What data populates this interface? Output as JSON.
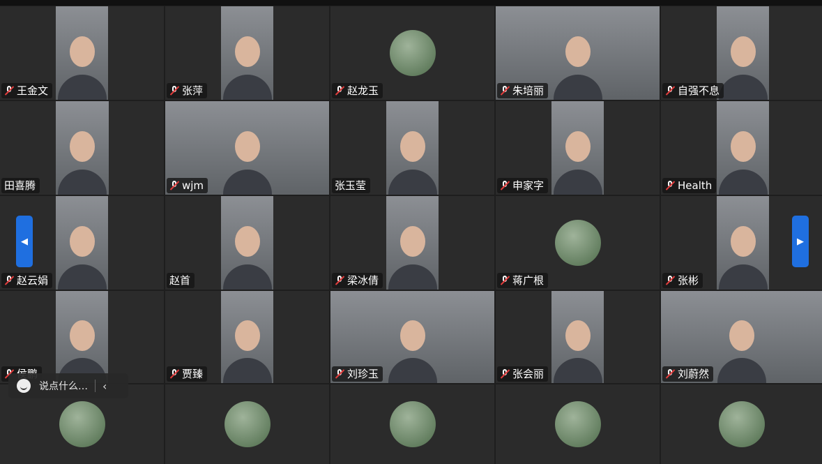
{
  "participants": [
    {
      "name": "王金文",
      "muted": true,
      "type": "video",
      "vx": 80,
      "vw": 75
    },
    {
      "name": "张萍",
      "muted": true,
      "type": "video",
      "vx": 80,
      "vw": 75
    },
    {
      "name": "赵龙玉",
      "muted": true,
      "type": "avatar"
    },
    {
      "name": "朱培丽",
      "muted": true,
      "type": "video",
      "vx": 0,
      "vw": 237
    },
    {
      "name": "自强不息",
      "muted": true,
      "type": "video",
      "vx": 80,
      "vw": 75
    },
    {
      "name": "田喜腾",
      "muted": false,
      "type": "video",
      "vx": 80,
      "vw": 76
    },
    {
      "name": "wjm",
      "muted": true,
      "type": "video",
      "vx": 0,
      "vw": 236
    },
    {
      "name": "张玉莹",
      "muted": false,
      "type": "video",
      "vx": 80,
      "vw": 75
    },
    {
      "name": "申家字",
      "muted": true,
      "type": "video",
      "vx": 80,
      "vw": 75
    },
    {
      "name": "Health",
      "muted": true,
      "type": "video",
      "vx": 80,
      "vw": 75
    },
    {
      "name": "赵云娟",
      "muted": true,
      "type": "video",
      "vx": 80,
      "vw": 75
    },
    {
      "name": "赵首",
      "muted": false,
      "type": "video",
      "vx": 80,
      "vw": 75
    },
    {
      "name": "梁冰倩",
      "muted": true,
      "type": "video",
      "vx": 80,
      "vw": 75
    },
    {
      "name": "蒋广根",
      "muted": true,
      "type": "avatar"
    },
    {
      "name": "张彬",
      "muted": true,
      "type": "video",
      "vx": 80,
      "vw": 75
    },
    {
      "name": "侯鹏",
      "muted": true,
      "type": "video",
      "vx": 80,
      "vw": 75
    },
    {
      "name": "贾臻",
      "muted": true,
      "type": "video",
      "vx": 80,
      "vw": 75
    },
    {
      "name": "刘珍玉",
      "muted": true,
      "type": "video",
      "vx": 0,
      "vw": 236
    },
    {
      "name": "张会丽",
      "muted": true,
      "type": "video",
      "vx": 80,
      "vw": 75
    },
    {
      "name": "刘蔚然",
      "muted": true,
      "type": "video",
      "vx": 0,
      "vw": 232
    },
    {
      "name": "",
      "muted": true,
      "type": "avatar"
    },
    {
      "name": "",
      "muted": true,
      "type": "avatar"
    },
    {
      "name": "",
      "muted": true,
      "type": "avatar"
    },
    {
      "name": "",
      "muted": true,
      "type": "avatar"
    },
    {
      "name": "",
      "muted": true,
      "type": "avatar"
    }
  ],
  "chat": {
    "placeholder": "说点什么…"
  },
  "nav": {
    "prev_icon": "◀",
    "next_icon": "▶"
  },
  "colors": {
    "accent": "#1f6fe0",
    "mute": "#e23c3c"
  }
}
